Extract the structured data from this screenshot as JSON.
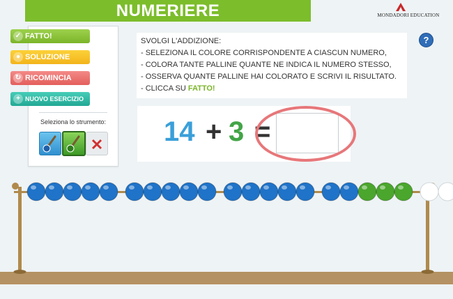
{
  "header": {
    "title": "NUMERIERE",
    "logo_text": "MONDADORI EDUCATION",
    "logo_icon": "mondadori-logo-icon"
  },
  "toolbar": {
    "buttons": [
      {
        "label": "FATTO!",
        "icon": "check-icon"
      },
      {
        "label": "SOLUZIONE",
        "icon": "lightbulb-icon"
      },
      {
        "label": "RICOMINCIA",
        "icon": "refresh-icon"
      },
      {
        "label": "NUOVO ESERCIZIO",
        "icon": "plus-icon"
      }
    ],
    "tool_label": "Seleziona lo strumento:",
    "tools": [
      {
        "name": "blue-brush-tool",
        "color": "#2f8fcf"
      },
      {
        "name": "green-brush-tool",
        "color": "#3d9a26",
        "selected": true
      },
      {
        "name": "eraser-tool",
        "icon": "x-icon"
      }
    ]
  },
  "instructions": {
    "lines": [
      "SVOLGI L'ADDIZIONE:",
      "- SELEZIONA IL COLORE CORRISPONDENTE A CIASCUN NUMERO,",
      "- COLORA TANTE PALLINE QUANTE NE INDICA IL NUMERO STESSO,",
      "- OSSERVA QUANTE PALLINE HAI COLORATO E SCRIVI IL RISULTATO."
    ],
    "last_prefix": "- CLICCA SU ",
    "last_highlight": "FATTO!"
  },
  "help_label": "?",
  "equation": {
    "a": "14",
    "plus": "+",
    "b": "3",
    "equals": "=",
    "answer": ""
  },
  "abacus": {
    "beads": [
      "blue",
      "blue",
      "blue",
      "blue",
      "blue",
      "blue",
      "blue",
      "blue",
      "blue",
      "blue",
      "blue",
      "blue",
      "blue",
      "blue",
      "blue",
      "blue",
      "blue",
      "green",
      "green",
      "green",
      "white",
      "white",
      "white"
    ],
    "colors": {
      "blue": "#1f73c8",
      "green": "#4aa62c",
      "white": "#ffffff",
      "rod": "#b08a4c",
      "base": "#b59263"
    }
  }
}
